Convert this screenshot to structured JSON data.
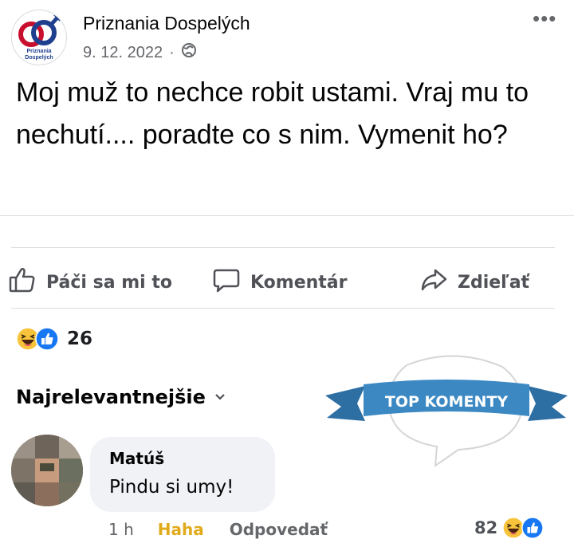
{
  "post": {
    "page_name": "Priznania Dospelých",
    "date": "9. 12. 2022",
    "separator": "·",
    "privacy_icon": "globe-icon",
    "more_icon": "more-dots-icon",
    "more_label": "•••",
    "text": "Moj muž to nechce robit ustami. Vraj mu to nechutí.... poradte co s nim. Vymenit ho?",
    "avatar_logo_text": [
      "Priznania",
      "Dospelých"
    ]
  },
  "actions": {
    "like_label": "Páči sa mi to",
    "comment_label": "Komentár",
    "share_label": "Zdieľať"
  },
  "reactions": {
    "icons": [
      "haha-emoji-icon",
      "like-thumb-icon"
    ],
    "count": "26"
  },
  "comments_sort": {
    "label": "Najrelevantnejšie",
    "icon": "chevron-down-icon"
  },
  "sticker": {
    "label": "TOP KOMENTY"
  },
  "comment": {
    "author": "Matúš",
    "text": "Pindu si umy!",
    "time": "1 h",
    "react_label": "Haha",
    "reply_label": "Odpovedať",
    "reaction_count": "82"
  },
  "colors": {
    "text_primary": "#050505",
    "text_secondary": "#65676b",
    "haha_yellow": "#f7c33a",
    "like_blue": "#1877f2",
    "ribbon_blue": "#3b88c3",
    "bubble_gray": "#f0f2f5"
  }
}
